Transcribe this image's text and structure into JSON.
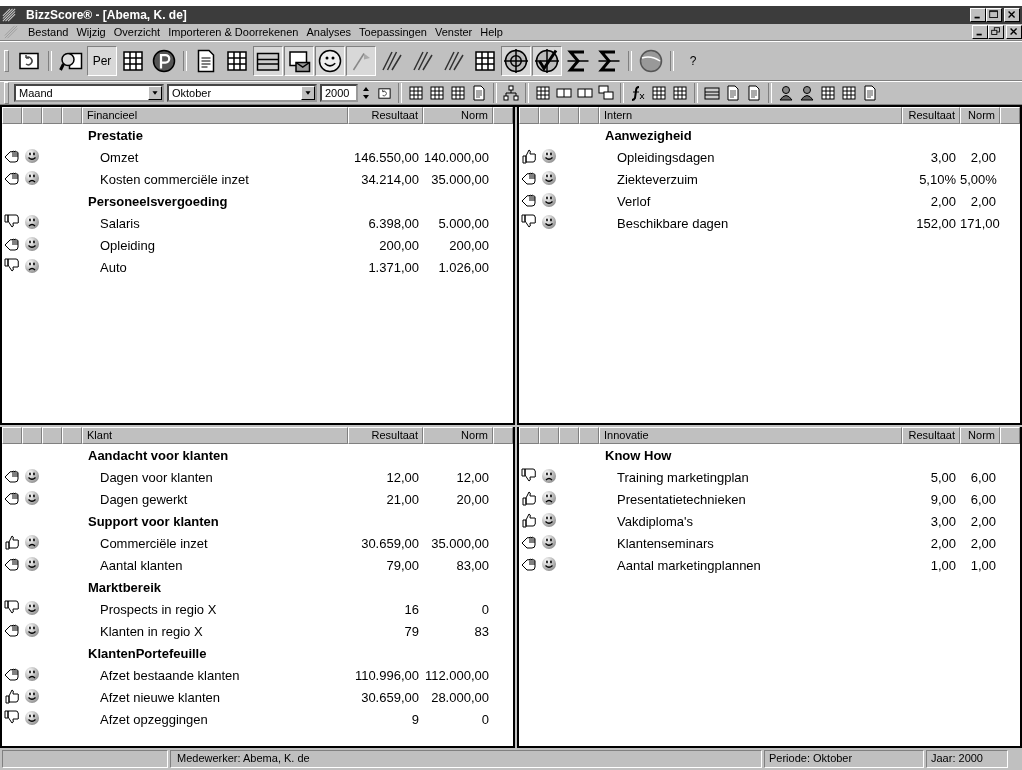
{
  "window": {
    "title": "BizzScore® - [Abema, K. de]"
  },
  "menu": [
    "Bestand",
    "Wijzig",
    "Overzicht",
    "Importeren & Doorrekenen",
    "Analyses",
    "Toepassingen",
    "Venster",
    "Help"
  ],
  "toolbar": [
    {
      "kind": "refresh",
      "pressed": false
    },
    {
      "kind": "sep"
    },
    {
      "kind": "magnifier",
      "pressed": false
    },
    {
      "kind": "text",
      "label": "Per",
      "pressed": true
    },
    {
      "kind": "grid",
      "pressed": false
    },
    {
      "kind": "coin",
      "pressed": false
    },
    {
      "kind": "sep"
    },
    {
      "kind": "doc",
      "pressed": false
    },
    {
      "kind": "grid",
      "pressed": false
    },
    {
      "kind": "cabinet",
      "pressed": true
    },
    {
      "kind": "envelope",
      "pressed": true
    },
    {
      "kind": "smiley",
      "pressed": true
    },
    {
      "kind": "flag",
      "pressed": true
    },
    {
      "kind": "lines",
      "pressed": false
    },
    {
      "kind": "lines",
      "pressed": false
    },
    {
      "kind": "lines",
      "pressed": false
    },
    {
      "kind": "grid",
      "pressed": false
    },
    {
      "kind": "target",
      "pressed": true
    },
    {
      "kind": "check",
      "pressed": true
    },
    {
      "kind": "sigma",
      "pressed": false
    },
    {
      "kind": "sigma",
      "pressed": false
    },
    {
      "kind": "sep"
    },
    {
      "kind": "globe",
      "pressed": false
    },
    {
      "kind": "sep"
    },
    {
      "kind": "text",
      "label": "?",
      "pressed": false
    }
  ],
  "filters": {
    "period_type": "Maand",
    "month": "Oktober",
    "year": "2000"
  },
  "toolbar2": [
    {
      "kind": "grid"
    },
    {
      "kind": "grid"
    },
    {
      "kind": "grid"
    },
    {
      "kind": "doc"
    },
    {
      "kind": "sep"
    },
    {
      "kind": "tree"
    },
    {
      "kind": "sep"
    },
    {
      "kind": "grid"
    },
    {
      "kind": "split"
    },
    {
      "kind": "split"
    },
    {
      "kind": "cascade"
    },
    {
      "kind": "sep"
    },
    {
      "kind": "function"
    },
    {
      "kind": "grid"
    },
    {
      "kind": "grid"
    },
    {
      "kind": "sep"
    },
    {
      "kind": "cabinet"
    },
    {
      "kind": "doc"
    },
    {
      "kind": "doc"
    },
    {
      "kind": "sep"
    },
    {
      "kind": "person"
    },
    {
      "kind": "person"
    },
    {
      "kind": "grid"
    },
    {
      "kind": "grid"
    },
    {
      "kind": "doc"
    }
  ],
  "panels": [
    {
      "title": "Financieel",
      "columns": [
        "Resultaat",
        "Norm"
      ],
      "rows": [
        {
          "kind": "group",
          "label": "Prestatie"
        },
        {
          "kind": "item",
          "label": "Omzet",
          "thumb": {
            "kind": "level"
          },
          "mood": {
            "kind": "happy"
          },
          "result": "146.550,00",
          "norm": "140.000,00"
        },
        {
          "kind": "item",
          "label": "Kosten commerciële inzet",
          "thumb": {
            "kind": "level"
          },
          "mood": {
            "kind": "sad"
          },
          "result": "34.214,00",
          "norm": "35.000,00"
        },
        {
          "kind": "group",
          "label": "Personeelsvergoeding"
        },
        {
          "kind": "item",
          "label": "Salaris",
          "thumb": {
            "kind": "down"
          },
          "mood": {
            "kind": "sad"
          },
          "result": "6.398,00",
          "norm": "5.000,00"
        },
        {
          "kind": "item",
          "label": "Opleiding",
          "thumb": {
            "kind": "level"
          },
          "mood": {
            "kind": "happy"
          },
          "result": "200,00",
          "norm": "200,00"
        },
        {
          "kind": "item",
          "label": "Auto",
          "thumb": {
            "kind": "down"
          },
          "mood": {
            "kind": "sad"
          },
          "result": "1.371,00",
          "norm": "1.026,00"
        }
      ]
    },
    {
      "title": "Intern",
      "columns": [
        "Resultaat",
        "Norm"
      ],
      "rows": [
        {
          "kind": "group",
          "label": "Aanwezigheid"
        },
        {
          "kind": "item",
          "label": "Opleidingsdagen",
          "thumb": {
            "kind": "up"
          },
          "mood": {
            "kind": "happy"
          },
          "result": "3,00",
          "norm": "2,00"
        },
        {
          "kind": "item",
          "label": "Ziekteverzuim",
          "thumb": {
            "kind": "level"
          },
          "mood": {
            "kind": "happy"
          },
          "result": "5,10%",
          "norm": "5,00%"
        },
        {
          "kind": "item",
          "label": "Verlof",
          "thumb": {
            "kind": "level"
          },
          "mood": {
            "kind": "happy"
          },
          "result": "2,00",
          "norm": "2,00"
        },
        {
          "kind": "item",
          "label": "Beschikbare dagen",
          "thumb": {
            "kind": "down"
          },
          "mood": {
            "kind": "happy"
          },
          "result": "152,00",
          "norm": "171,00"
        }
      ]
    },
    {
      "title": "Klant",
      "columns": [
        "Resultaat",
        "Norm"
      ],
      "rows": [
        {
          "kind": "group",
          "label": "Aandacht voor klanten"
        },
        {
          "kind": "item",
          "label": "Dagen voor klanten",
          "thumb": {
            "kind": "level"
          },
          "mood": {
            "kind": "happy"
          },
          "result": "12,00",
          "norm": "12,00"
        },
        {
          "kind": "item",
          "label": "Dagen gewerkt",
          "thumb": {
            "kind": "level"
          },
          "mood": {
            "kind": "happy"
          },
          "result": "21,00",
          "norm": "20,00"
        },
        {
          "kind": "group",
          "label": "Support voor klanten"
        },
        {
          "kind": "item",
          "label": "Commerciële inzet",
          "thumb": {
            "kind": "up"
          },
          "mood": {
            "kind": "sad"
          },
          "result": "30.659,00",
          "norm": "35.000,00"
        },
        {
          "kind": "item",
          "label": "Aantal klanten",
          "thumb": {
            "kind": "level"
          },
          "mood": {
            "kind": "happy"
          },
          "result": "79,00",
          "norm": "83,00"
        },
        {
          "kind": "group",
          "label": "Marktbereik"
        },
        {
          "kind": "item",
          "label": "Prospects in regio X",
          "thumb": {
            "kind": "down"
          },
          "mood": {
            "kind": "happy"
          },
          "result": "16",
          "norm": "0"
        },
        {
          "kind": "item",
          "label": "Klanten in regio X",
          "thumb": {
            "kind": "level"
          },
          "mood": {
            "kind": "happy"
          },
          "result": "79",
          "norm": "83"
        },
        {
          "kind": "group",
          "label": "KlantenPortefeuille"
        },
        {
          "kind": "item",
          "label": "Afzet bestaande klanten",
          "thumb": {
            "kind": "level"
          },
          "mood": {
            "kind": "sad"
          },
          "result": "110.996,00",
          "norm": "112.000,00"
        },
        {
          "kind": "item",
          "label": "Afzet nieuwe klanten",
          "thumb": {
            "kind": "up"
          },
          "mood": {
            "kind": "happy"
          },
          "result": "30.659,00",
          "norm": "28.000,00"
        },
        {
          "kind": "item",
          "label": "Afzet opzeggingen",
          "thumb": {
            "kind": "down"
          },
          "mood": {
            "kind": "happy"
          },
          "result": "9",
          "norm": "0"
        }
      ]
    },
    {
      "title": "Innovatie",
      "columns": [
        "Resultaat",
        "Norm"
      ],
      "rows": [
        {
          "kind": "group",
          "label": "Know How"
        },
        {
          "kind": "item",
          "label": "Training marketingplan",
          "thumb": {
            "kind": "down"
          },
          "mood": {
            "kind": "sad"
          },
          "result": "5,00",
          "norm": "6,00"
        },
        {
          "kind": "item",
          "label": "Presentatietechnieken",
          "thumb": {
            "kind": "up"
          },
          "mood": {
            "kind": "sad"
          },
          "result": "9,00",
          "norm": "6,00"
        },
        {
          "kind": "item",
          "label": "Vakdiploma's",
          "thumb": {
            "kind": "up"
          },
          "mood": {
            "kind": "happy"
          },
          "result": "3,00",
          "norm": "2,00"
        },
        {
          "kind": "item",
          "label": "Klantenseminars",
          "thumb": {
            "kind": "level"
          },
          "mood": {
            "kind": "happy"
          },
          "result": "2,00",
          "norm": "2,00"
        },
        {
          "kind": "item",
          "label": "Aantal marketingplannen",
          "thumb": {
            "kind": "level"
          },
          "mood": {
            "kind": "happy"
          },
          "result": "1,00",
          "norm": "1,00"
        }
      ]
    }
  ],
  "status_bar": [
    "Medewerker: Abema, K. de",
    "Periode: Oktober",
    "Jaar: 2000"
  ]
}
